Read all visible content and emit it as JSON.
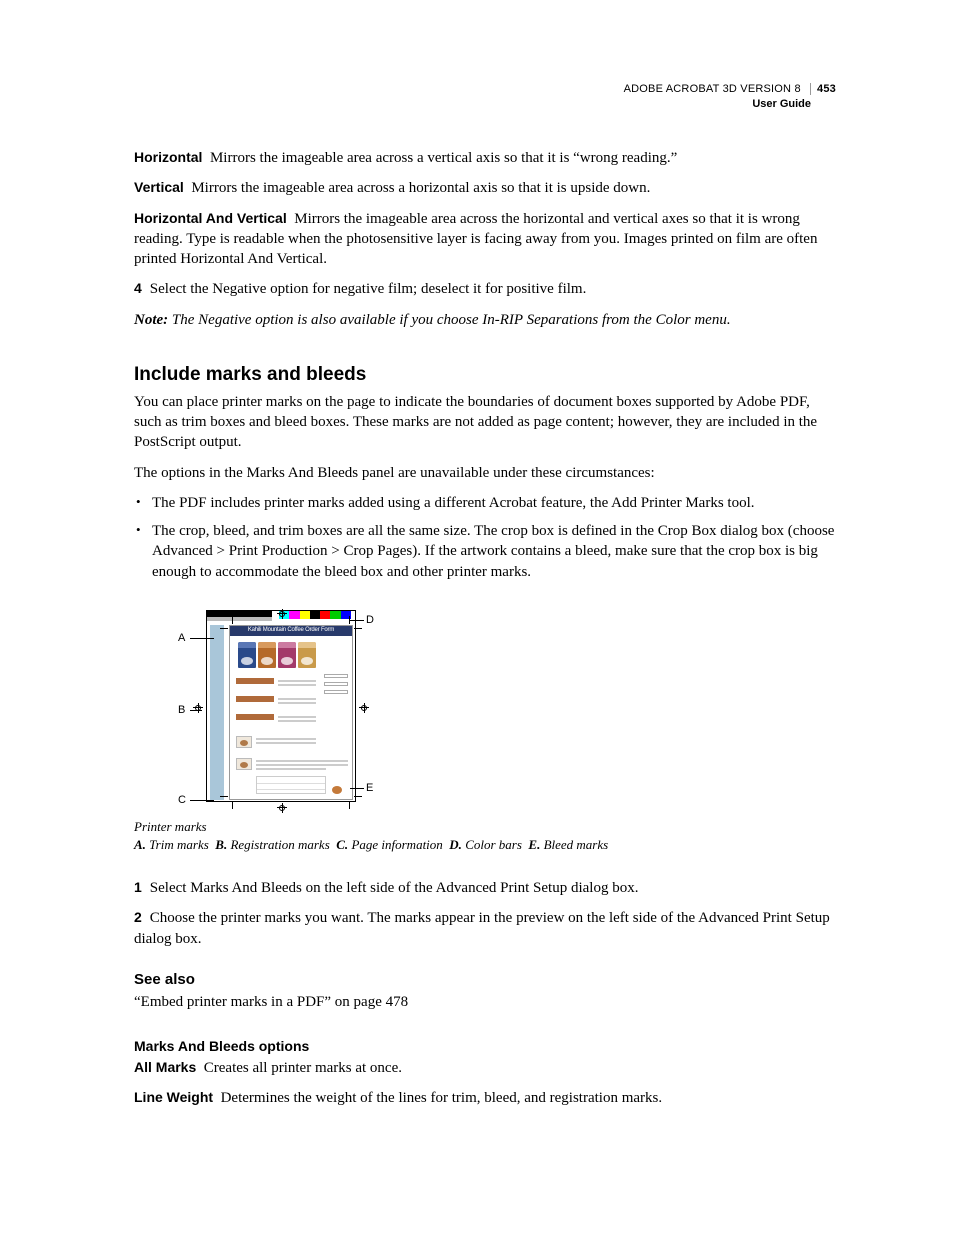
{
  "header": {
    "product": "ADOBE ACROBAT 3D VERSION 8",
    "page": "453",
    "guide": "User Guide"
  },
  "defs": {
    "horizontal": {
      "t": "Horizontal",
      "d": "Mirrors the imageable area across a vertical axis so that it is “wrong reading.”"
    },
    "vertical": {
      "t": "Vertical",
      "d": "Mirrors the imageable area across a horizontal axis so that it is upside down."
    },
    "hv": {
      "t": "Horizontal And Vertical",
      "d": "Mirrors the imageable area across the horizontal and vertical axes so that it is wrong reading. Type is readable when the photosensitive layer is facing away from you. Images printed on film are often printed Horizontal And Vertical."
    }
  },
  "step4": {
    "n": "4",
    "txt": "Select the Negative option for negative film; deselect it for positive film."
  },
  "note": {
    "lbl": "Note:",
    "txt": "The Negative option is also available if you choose In-RIP Separations from the Color menu."
  },
  "sec": {
    "title": "Include marks and bleeds",
    "p1": "You can place printer marks on the page to indicate the boundaries of document boxes supported by Adobe PDF, such as trim boxes and bleed boxes. These marks are not added as page content; however, they are included in the PostScript output.",
    "p2": "The options in the Marks And Bleeds panel are unavailable under these circumstances:",
    "b1": "The PDF includes printer marks added using a different Acrobat feature, the Add Printer Marks tool.",
    "b2": "The crop, bleed, and trim boxes are all the same size. The crop box is defined in the Crop Box dialog box (choose Advanced > Print Production > Crop Pages). If the artwork contains a bleed, make sure that the crop box is big enough to accommodate the bleed box and other printer marks."
  },
  "fig": {
    "A": "A",
    "B": "B",
    "C": "C",
    "D": "D",
    "E": "E",
    "innerTitle": "Kahili Mountain Coffee Order Form",
    "cap_title": "Printer marks",
    "cap": {
      "A": "Trim marks",
      "B": "Registration marks",
      "C": "Page information",
      "D": "Color bars",
      "E": "Bleed marks"
    }
  },
  "steps2": {
    "s1n": "1",
    "s1": "Select Marks And Bleeds on the left side of the Advanced Print Setup dialog box.",
    "s2n": "2",
    "s2": "Choose the printer marks you want. The marks appear in the preview on the left side of the Advanced Print Setup dialog box."
  },
  "seealso": {
    "title": "See also",
    "link": "“Embed printer marks in a PDF” on page 478"
  },
  "opts": {
    "title": "Marks And Bleeds options",
    "allmarks": {
      "t": "All Marks",
      "d": "Creates all printer marks at once."
    },
    "lineweight": {
      "t": "Line Weight",
      "d": "Determines the weight of the lines for trim, bleed, and registration marks."
    }
  }
}
